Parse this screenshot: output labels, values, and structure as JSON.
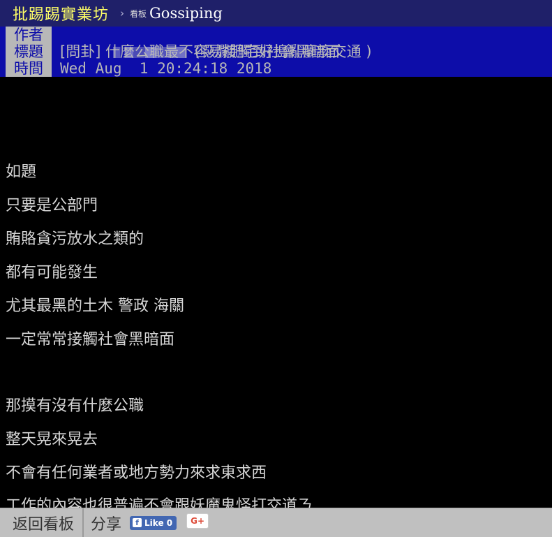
{
  "topbar": {
    "site_name": "批踢踢實業坊",
    "separator": "›",
    "board_word": "看板",
    "board_name": "Gossiping"
  },
  "meta": {
    "author_tag": "作者",
    "author_nick": "(噁爛肥宅好搗亂癱瘓交通 )",
    "title_tag": "標題",
    "title": "[問卦] 什麼公職最不容易接觸到社會黑暗面",
    "time_tag": "時間",
    "time": "Wed Aug  1 20:24:18 2018"
  },
  "content": {
    "lines": [
      "如題",
      "只要是公部門",
      "賄賂貪污放水之類的",
      "都有可能發生",
      "尤其最黑的土木 警政 海關",
      "一定常常接觸社會黑暗面",
      "那摸有沒有什麼公職",
      "整天晃來晃去",
      "不會有任何業者或地方勢力來求東求西",
      "工作的內容也很普遍不會跟妖魔鬼怪打交道ㄋ"
    ]
  },
  "footer": {
    "back_label": "返回看板",
    "share_label": "分享",
    "like_label": "Like 0",
    "like_icon": "f",
    "gplus_label": "G+"
  },
  "colors": {
    "topbar_bg": "#1f2069",
    "site_name": "#ffff66",
    "meta_bg": "#0d0da9",
    "meta_tag_bg": "#b8b8b8",
    "body_bg": "#000000",
    "body_text": "#d6d6d6",
    "footer_bg": "#c0c0c0"
  }
}
